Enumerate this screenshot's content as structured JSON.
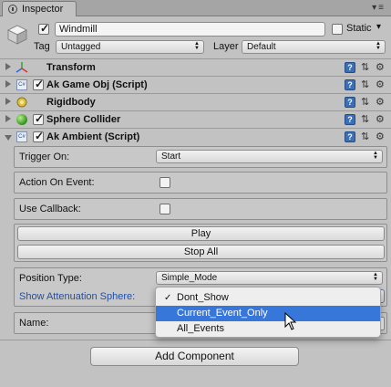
{
  "window": {
    "tab_title": "Inspector",
    "tab_controls": "▾≡"
  },
  "header": {
    "object_name": "Windmill",
    "active": true,
    "static_label": "Static",
    "static_checked": false,
    "tag_label": "Tag",
    "tag_value": "Untagged",
    "layer_label": "Layer",
    "layer_value": "Default"
  },
  "components": [
    {
      "name": "Transform",
      "icon": "transform-axes-icon",
      "has_checkbox": false,
      "expanded": false
    },
    {
      "name": "Ak Game Obj (Script)",
      "icon": "script-icon",
      "has_checkbox": true,
      "expanded": false
    },
    {
      "name": "Rigidbody",
      "icon": "rigidbody-icon",
      "has_checkbox": false,
      "expanded": false
    },
    {
      "name": "Sphere Collider",
      "icon": "sphere-collider-icon",
      "has_checkbox": true,
      "expanded": false
    },
    {
      "name": "Ak Ambient (Script)",
      "icon": "script-icon",
      "has_checkbox": true,
      "expanded": true
    }
  ],
  "ambient": {
    "trigger_on_label": "Trigger On:",
    "trigger_on_value": "Start",
    "action_on_event_label": "Action On Event:",
    "action_on_event_checked": false,
    "use_callback_label": "Use Callback:",
    "use_callback_checked": false,
    "play_label": "Play",
    "stop_all_label": "Stop All",
    "position_type_label": "Position Type:",
    "position_type_value": "Simple_Mode",
    "show_attenuation_label": "Show Attenuation Sphere:",
    "name_label": "Name:"
  },
  "dropdown_menu": {
    "items": [
      {
        "label": "Dont_Show",
        "checked": true,
        "highlighted": false
      },
      {
        "label": "Current_Event_Only",
        "checked": false,
        "highlighted": true
      },
      {
        "label": "All_Events",
        "checked": false,
        "highlighted": false
      }
    ]
  },
  "footer": {
    "add_component_label": "Add Component"
  },
  "colors": {
    "highlight": "#3777d9",
    "link_label": "#1f4fa8",
    "panel_bg": "#c2c2c2"
  }
}
